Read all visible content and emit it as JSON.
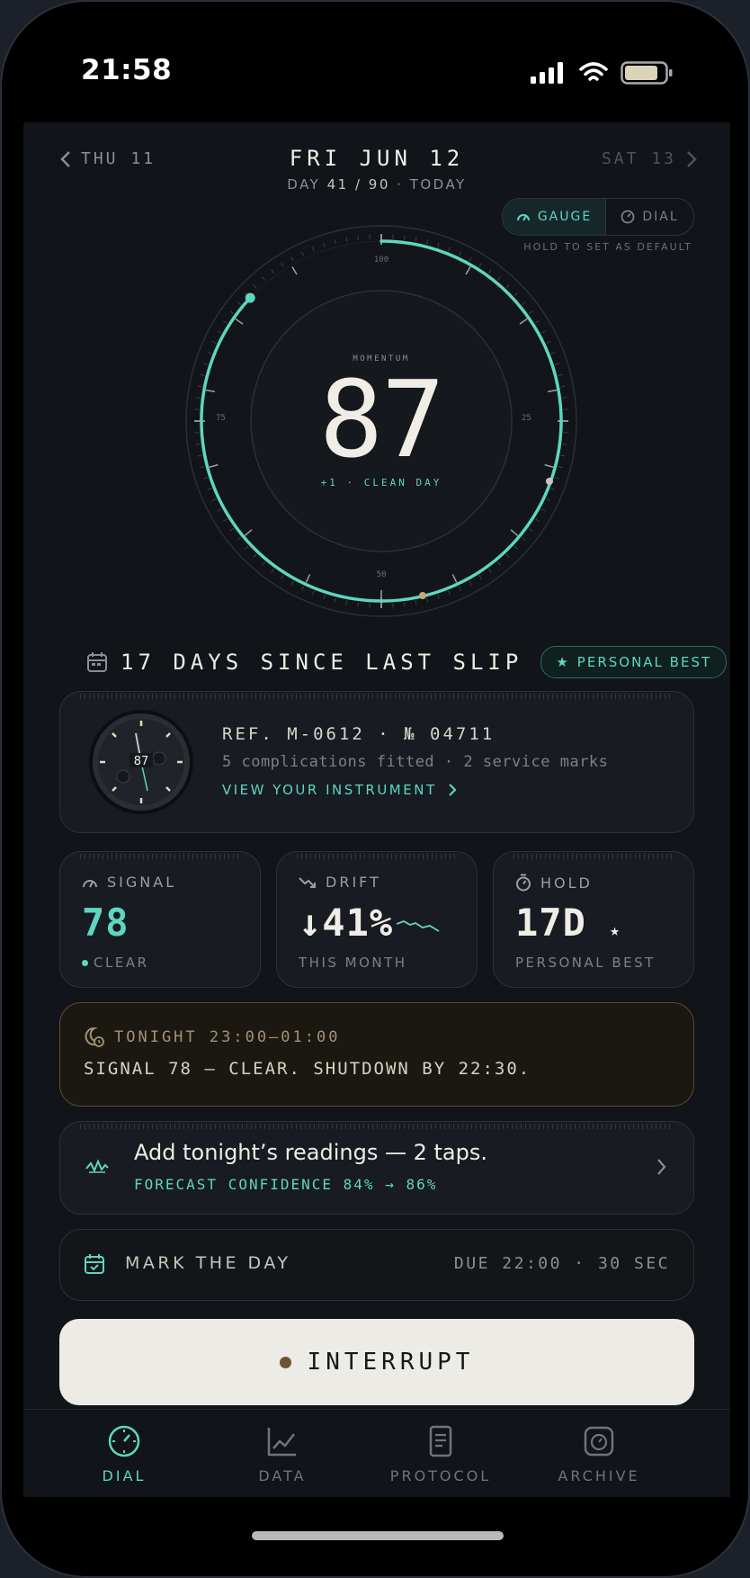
{
  "status": {
    "time": "21:58"
  },
  "header": {
    "prev_day": "THU 11",
    "next_day": "SAT 13",
    "title": "FRI JUN 12",
    "day_prefix": "DAY",
    "day_current": "41 / 90",
    "day_suffix": "· TODAY"
  },
  "view_toggle": {
    "options": [
      {
        "label": "GAUGE",
        "icon": "gauge-icon",
        "selected": true
      },
      {
        "label": "DIAL",
        "icon": "dial-icon",
        "selected": false
      }
    ],
    "hint": "HOLD TO SET AS DEFAULT"
  },
  "gauge": {
    "label": "MOMENTUM",
    "value": "87",
    "delta": "+1 · CLEAN DAY",
    "scale_labels": {
      "top": "100",
      "right": "25",
      "bottom": "50",
      "left": "75"
    },
    "level": 0.87
  },
  "streak": {
    "text": "17 DAYS SINCE LAST SLIP",
    "badge": "PERSONAL BEST"
  },
  "instrument": {
    "ref": "REF. M-0612 · № 04711",
    "subtitle": "5 complications fitted · 2 service marks",
    "link": "VIEW YOUR INSTRUMENT",
    "watch_value": "87"
  },
  "stats": [
    {
      "label": "SIGNAL",
      "value": "78",
      "foot": "CLEAR",
      "icon": "signal-gauge-icon"
    },
    {
      "label": "DRIFT",
      "value": "↓41%",
      "foot": "THIS MONTH",
      "icon": "trend-down-icon"
    },
    {
      "label": "HOLD",
      "value": "17D",
      "star": "★",
      "foot": "PERSONAL BEST",
      "icon": "stopwatch-icon"
    }
  ],
  "tonight": {
    "heading": "TONIGHT 23:00–01:00",
    "message": "SIGNAL 78 — CLEAR. SHUTDOWN BY 22:30."
  },
  "readings": {
    "title": "Add tonight’s readings — 2 taps.",
    "subtitle": "FORECAST CONFIDENCE 84% → 86%"
  },
  "mark_day": {
    "label": "MARK THE DAY",
    "due": "DUE 22:00 · 30 SEC"
  },
  "interrupt": {
    "label": "INTERRUPT"
  },
  "nav": [
    {
      "label": "DIAL",
      "active": true
    },
    {
      "label": "DATA",
      "active": false
    },
    {
      "label": "PROTOCOL",
      "active": false
    },
    {
      "label": "ARCHIVE",
      "active": false
    }
  ],
  "colors": {
    "accent": "#5ed6c0",
    "background": "#111418",
    "card": "#181b21",
    "warm_border": "#5b4a32",
    "button": "#ecebe5"
  }
}
